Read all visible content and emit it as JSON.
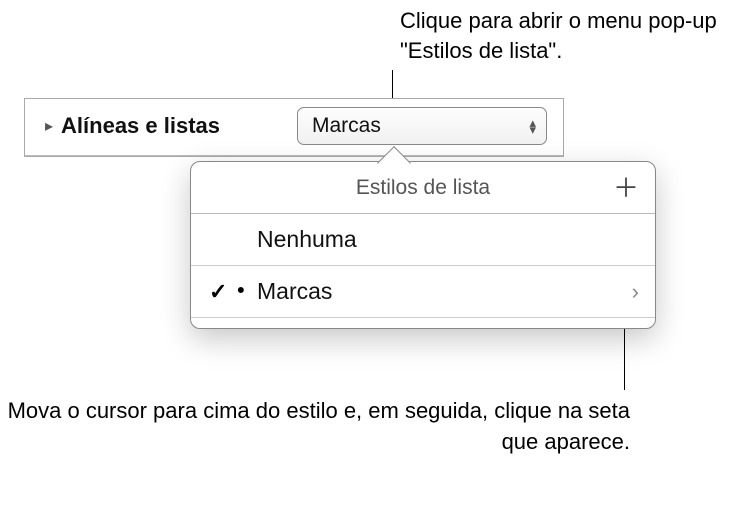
{
  "callouts": {
    "top": "Clique para abrir o menu pop-up \"Estilos de lista\".",
    "bottom": "Mova o cursor para cima do estilo e, em seguida, clique na seta que aparece."
  },
  "panel": {
    "section_label": "Alíneas e listas",
    "popup_value": "Marcas"
  },
  "popover": {
    "title": "Estilos de lista",
    "items": {
      "0": {
        "label": "Nenhuma"
      },
      "1": {
        "label": "Marcas"
      }
    }
  }
}
